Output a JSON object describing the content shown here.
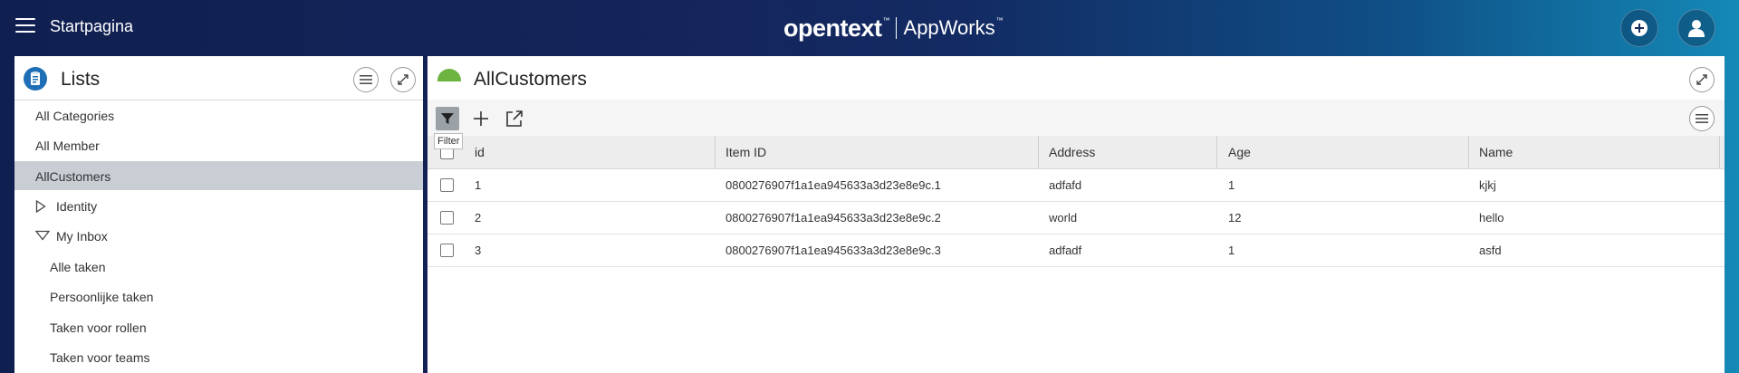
{
  "header": {
    "home_title": "Startpagina",
    "brand_name": "opentext",
    "brand_tm": "™",
    "product_name": "AppWorks",
    "product_tm": "™"
  },
  "lists_panel": {
    "title": "Lists",
    "items": [
      {
        "label": "All Categories"
      },
      {
        "label": "All Member"
      },
      {
        "label": "AllCustomers",
        "selected": true
      },
      {
        "label": "Identity",
        "expander": "collapsed"
      },
      {
        "label": "My Inbox",
        "expander": "expanded"
      },
      {
        "label": "Alle taken"
      },
      {
        "label": "Persoonlijke taken"
      },
      {
        "label": "Taken voor rollen"
      },
      {
        "label": "Taken voor teams"
      }
    ]
  },
  "content_panel": {
    "title": "AllCustomers",
    "filter_tooltip": "Filter",
    "columns": [
      "id",
      "Item ID",
      "Address",
      "Age",
      "Name"
    ],
    "rows": [
      [
        "1",
        "0800276907f1a1ea945633a3d23e8e9c.1",
        "adfafd",
        "1",
        "kjkj"
      ],
      [
        "2",
        "0800276907f1a1ea945633a3d23e8e9c.2",
        "world",
        "12",
        "hello"
      ],
      [
        "3",
        "0800276907f1a1ea945633a3d23e8e9c.3",
        "adfadf",
        "1",
        "asfd"
      ]
    ]
  },
  "icons": {
    "menu": "hamburger-menu-icon",
    "add": "plus-circle-icon",
    "user": "user-icon",
    "lists": "clipboard-list-icon",
    "options": "options-menu-icon",
    "expand": "expand-icon",
    "filter": "filter-icon",
    "new": "plus-icon",
    "open": "open-external-icon"
  }
}
